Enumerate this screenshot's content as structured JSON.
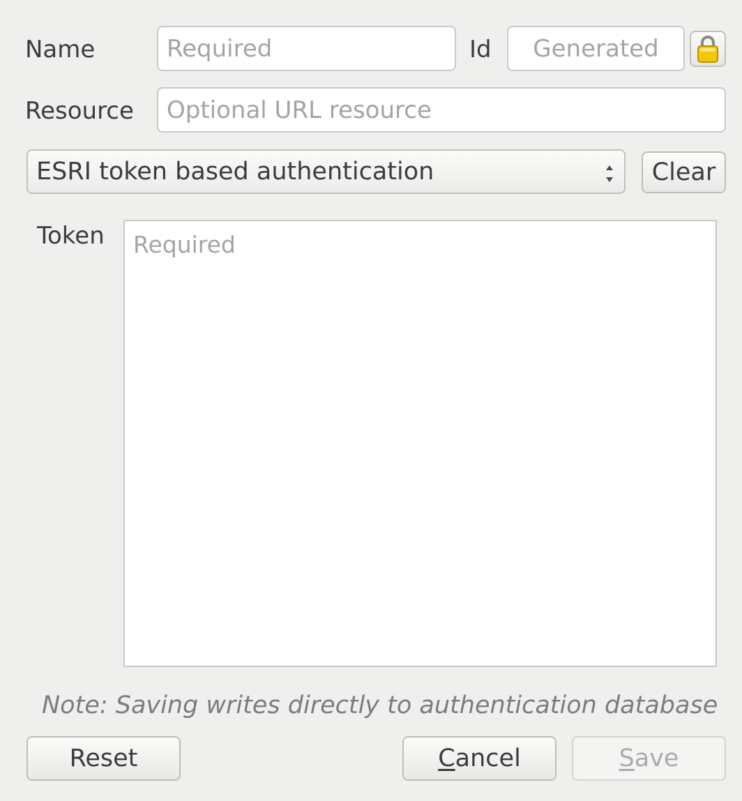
{
  "form": {
    "name_label": "Name",
    "name_placeholder": "Required",
    "id_label": "Id",
    "id_placeholder": "Generated",
    "lock_icon": "lock-icon",
    "resource_label": "Resource",
    "resource_placeholder": "Optional URL resource"
  },
  "auth": {
    "method_selected": "ESRI token based authentication",
    "clear_label": "Clear",
    "token_label": "Token",
    "token_placeholder": "Required"
  },
  "footer": {
    "note": "Note: Saving writes directly to authentication database",
    "reset_label": "Reset",
    "cancel_label_prefix": "C",
    "cancel_label_rest": "ancel",
    "save_label_prefix": "S",
    "save_label_rest": "ave"
  },
  "colors": {
    "background": "#efefee",
    "lock_yellow": "#f2c80f",
    "placeholder": "#a4a4a4",
    "note_text": "#7c7c7c"
  }
}
